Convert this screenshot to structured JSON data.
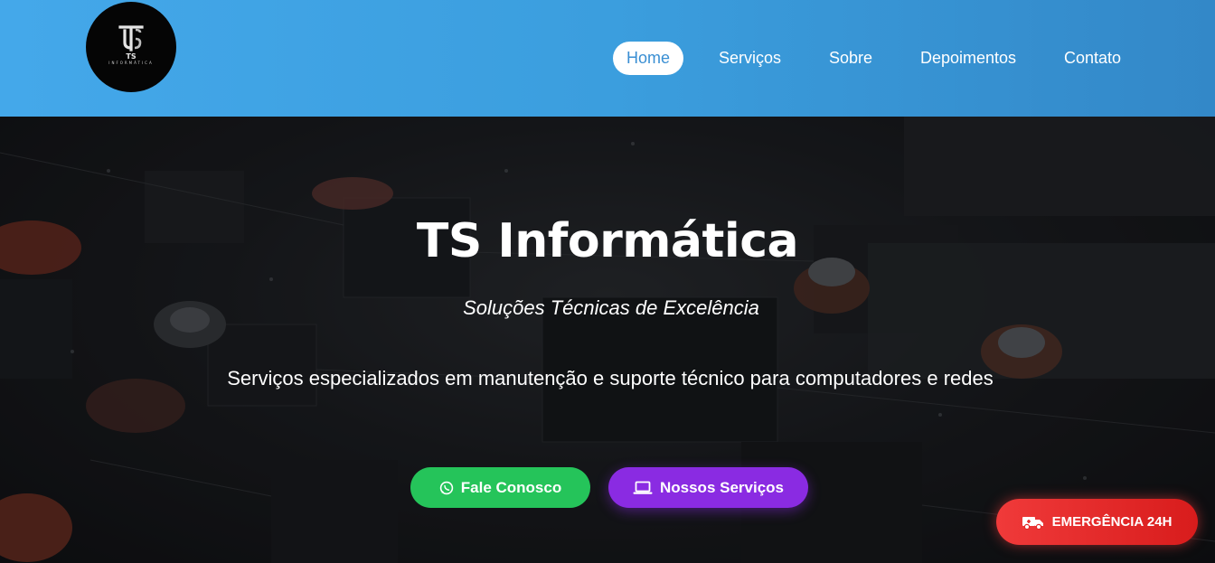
{
  "brand": {
    "logo_text": "TS",
    "logo_subtext": "INFORMÁTICA"
  },
  "nav": {
    "items": [
      {
        "label": "Home",
        "active": true
      },
      {
        "label": "Serviços",
        "active": false
      },
      {
        "label": "Sobre",
        "active": false
      },
      {
        "label": "Depoimentos",
        "active": false
      },
      {
        "label": "Contato",
        "active": false
      }
    ]
  },
  "hero": {
    "title": "TS Informática",
    "subtitle": "Soluções Técnicas de Excelência",
    "description": "Serviços especializados em manutenção e suporte técnico para computadores e redes",
    "buttons": {
      "contact": {
        "label": "Fale Conosco",
        "icon": "whatsapp-icon",
        "color": "#25c45a"
      },
      "services": {
        "label": "Nossos Serviços",
        "icon": "laptop-icon",
        "color": "#8a2be2"
      }
    },
    "background": "circuit-board-photo"
  },
  "emergency": {
    "label": "EMERGÊNCIA 24H",
    "icon": "truck-icon",
    "color": "#e32626"
  },
  "colors": {
    "header": "#3b9ede",
    "nav_active_text": "#3a8fd3"
  }
}
